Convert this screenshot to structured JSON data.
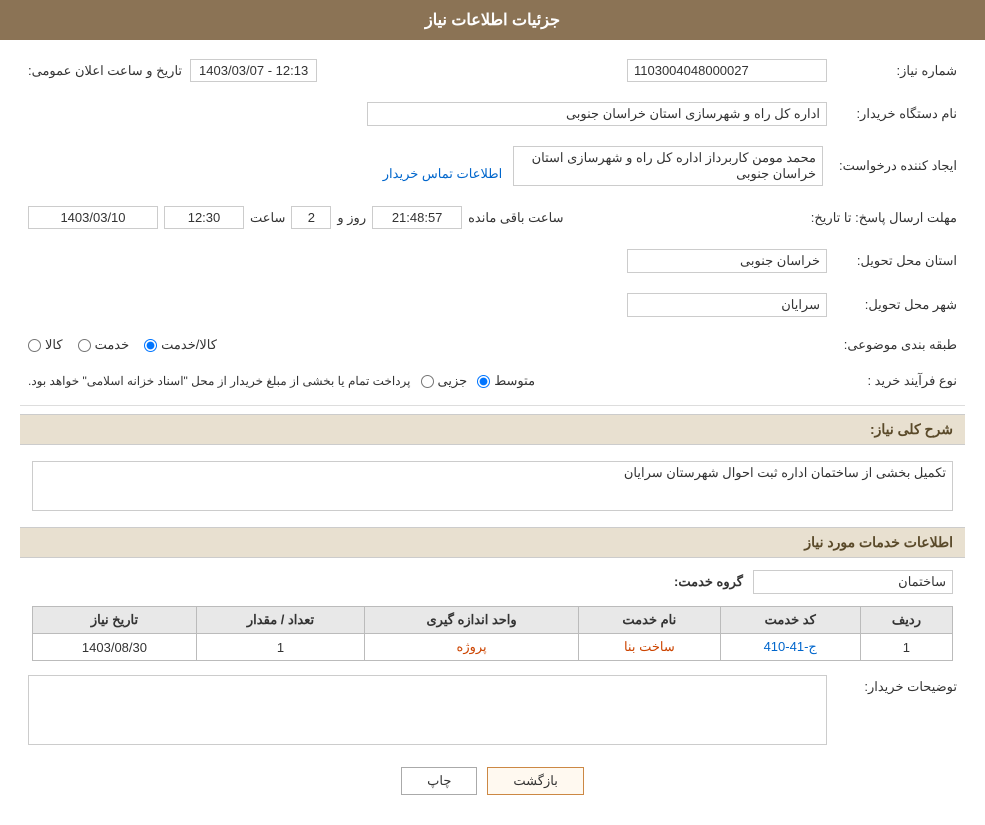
{
  "page": {
    "title": "جزئیات اطلاعات نیاز"
  },
  "header": {
    "announcement_label": "تاریخ و ساعت اعلان عمومی:",
    "announcement_value": "1403/03/07 - 12:13",
    "need_number_label": "شماره نیاز:",
    "need_number_value": "1103004048000027"
  },
  "fields": {
    "buyer_org_label": "نام دستگاه خریدار:",
    "buyer_org_value": "اداره کل راه و شهرسازی استان خراسان جنوبی",
    "requester_label": "ایجاد کننده درخواست:",
    "requester_value": "محمد مومن کاربرداز اداره کل راه و شهرسازی استان خراسان جنوبی",
    "requester_link": "اطلاعات تماس خریدار",
    "response_deadline_label": "مهلت ارسال پاسخ: تا تاریخ:",
    "response_date": "1403/03/10",
    "response_time_label": "ساعت",
    "response_time": "12:30",
    "response_days_label": "روز و",
    "response_days": "2",
    "response_remaining_label": "ساعت باقی مانده",
    "response_remaining": "21:48:57",
    "delivery_province_label": "استان محل تحویل:",
    "delivery_province_value": "خراسان جنوبی",
    "delivery_city_label": "شهر محل تحویل:",
    "delivery_city_value": "سرایان",
    "category_label": "طبقه بندی موضوعی:",
    "category_options": [
      {
        "id": "kala",
        "label": "کالا",
        "selected": false
      },
      {
        "id": "khedmat",
        "label": "خدمت",
        "selected": false
      },
      {
        "id": "kala_khedmat",
        "label": "کالا/خدمت",
        "selected": true
      }
    ],
    "purchase_type_label": "نوع فرآیند خرید :",
    "purchase_type_options": [
      {
        "id": "jozvi",
        "label": "جزیی",
        "selected": false
      },
      {
        "id": "motavasset",
        "label": "متوسط",
        "selected": true
      },
      {
        "id": "total",
        "label": "پرداخت تمام یا بخشی از مبلغ خریدار از محل \"اسناد خزانه اسلامی\" خواهد بود.",
        "selected": false
      }
    ],
    "need_description_label": "شرح کلی نیاز:",
    "need_description_value": "تکمیل بخشی از ساختمان اداره ثبت احوال شهرستان سرایان"
  },
  "services_section": {
    "title": "اطلاعات خدمات مورد نیاز",
    "service_group_label": "گروه خدمت:",
    "service_group_value": "ساختمان",
    "table": {
      "headers": [
        "ردیف",
        "کد خدمت",
        "نام خدمت",
        "واحد اندازه گیری",
        "تعداد / مقدار",
        "تاریخ نیاز"
      ],
      "rows": [
        {
          "row_num": "1",
          "service_code": "ج-41-410",
          "service_name": "ساخت بنا",
          "unit": "پروژه",
          "quantity": "1",
          "date": "1403/08/30"
        }
      ]
    }
  },
  "buyer_description": {
    "label": "توضیحات خریدار:",
    "value": ""
  },
  "buttons": {
    "print_label": "چاپ",
    "back_label": "بازگشت"
  }
}
